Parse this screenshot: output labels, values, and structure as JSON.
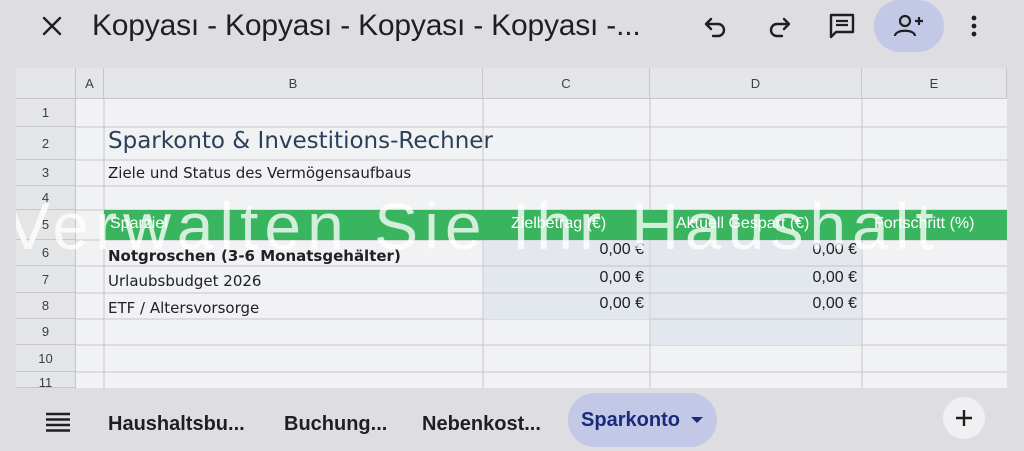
{
  "app": {
    "doc_title": "Kopyası - Kopyası - Kopyası - Kopyası -..."
  },
  "grid": {
    "columns": [
      "A",
      "B",
      "C",
      "D",
      "E"
    ],
    "rows": [
      "1",
      "2",
      "3",
      "4",
      "5",
      "6",
      "7",
      "8",
      "9",
      "10",
      "11"
    ],
    "title": "Sparkonto & Investitions-Rechner",
    "subtitle": "Ziele und Status des Vermögensaufbaus",
    "header_row": {
      "goal": "Sparziel",
      "target": "Zielbetrag (€)",
      "current": "Aktuell Gespart (€)",
      "progress": "Fortschritt (%)"
    },
    "items": [
      {
        "label": "Notgroschen (3-6 Monatsgehälter)",
        "target": "0,00 €",
        "current": "0,00 €"
      },
      {
        "label": "Urlaubsbudget 2026",
        "target": "0,00 €",
        "current": "0,00 €"
      },
      {
        "label": "ETF / Altersvorsorge",
        "target": "0,00 €",
        "current": "0,00 €"
      }
    ],
    "overlay_text": "Verwalten Sie Ihr Haushalt"
  },
  "tabs": {
    "items": [
      "Haushaltsbu...",
      "Buchung...",
      "Nebenkost..."
    ],
    "active": "Sparkonto"
  },
  "colors": {
    "accent_bg": "#c3c8e6",
    "header_green": "#3ab55f",
    "title_blue": "#2c3f5b"
  }
}
